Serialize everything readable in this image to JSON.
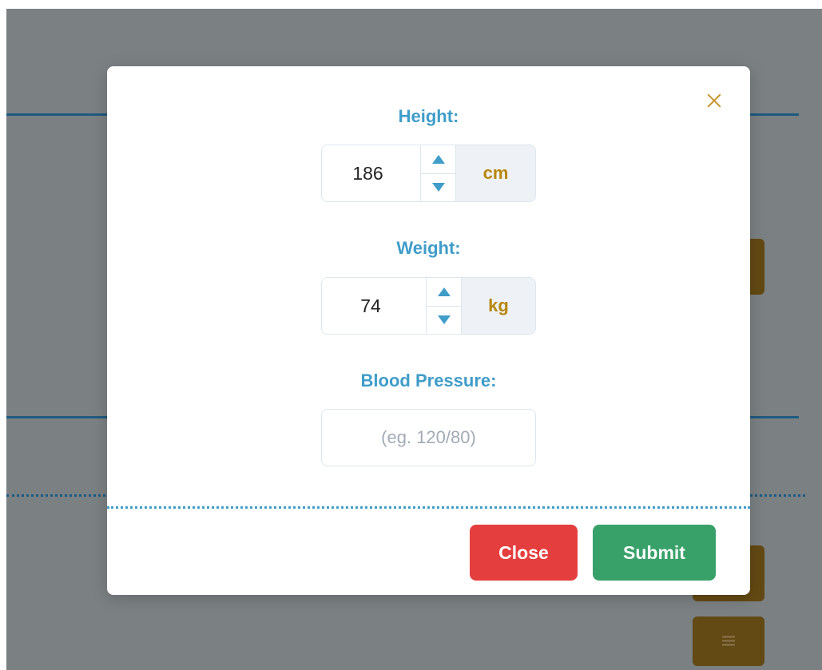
{
  "modal": {
    "height": {
      "label": "Height:",
      "value": "186",
      "unit": "cm"
    },
    "weight": {
      "label": "Weight:",
      "value": "74",
      "unit": "kg"
    },
    "blood_pressure": {
      "label": "Blood Pressure:",
      "value": "",
      "placeholder": "(eg. 120/80)"
    },
    "buttons": {
      "close_label": "Close",
      "submit_label": "Submit"
    }
  },
  "icons": {
    "dismiss": "close-icon",
    "increment": "triangle-up-icon",
    "decrement": "triangle-down-icon",
    "background_menu": "hamburger-menu-icon"
  },
  "colors": {
    "label": "#3f9dc9",
    "unit": "#b8860b",
    "close_button": "#e53e3e",
    "submit_button": "#38a169",
    "dismiss_icon": "#c8932b",
    "overlay": "#7b8083"
  }
}
